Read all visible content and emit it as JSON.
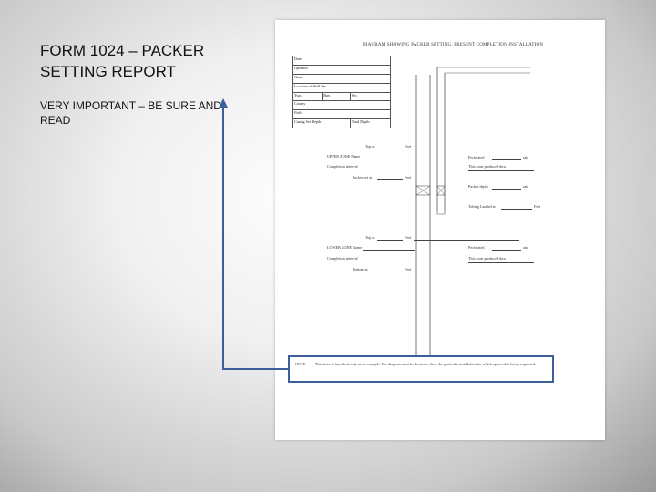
{
  "slide": {
    "title": "FORM 1024 – PACKER SETTING REPORT",
    "note": "VERY IMPORTANT – BE SURE AND READ"
  },
  "form": {
    "heading": "DIAGRAM SHOWING PACKER SETTING, PRESENT COMPLETION INSTALLATION",
    "header_rows": [
      [
        "Date",
        "",
        ""
      ],
      [
        "Operator",
        "",
        ""
      ],
      [
        "Name",
        "",
        ""
      ],
      [
        "Location of Well Sec.",
        "",
        ""
      ],
      [
        "Twp.",
        "Rge.",
        "Sec."
      ],
      [
        "County",
        "",
        ""
      ],
      [
        "Field",
        "",
        ""
      ],
      [
        "Casing Set Depth",
        "Total Depth",
        ""
      ]
    ],
    "fields": {
      "top_at_1": "Top at",
      "feet_1": "Feet",
      "upper_zone_name": "UPPER ZONE Name",
      "completion_interval_1": "Completion interval",
      "packer_set_at_1": "Packer set at",
      "feet_2": "Feet",
      "perforated_1": "Perforated",
      "rate_1": "rate",
      "zone_produced_1": "This zone produced thru",
      "packer_depth": "Packer depth",
      "rate_2": "rate",
      "tubing_landed_at": "Tubing Landed at",
      "feet_3": "Feet",
      "top_at_2": "Top at",
      "feet_4": "Feet",
      "lower_zone_name": "LOWER ZONE Name",
      "perforated_2": "Perforated",
      "rate_3": "rate",
      "completion_interval_2": "Completion interval",
      "zone_produced_2": "This zone produced thru",
      "bottom_at": "Bottom at",
      "feet_5": "Feet"
    },
    "note_label": "NOTE:",
    "note_text": "This form is furnished only as an example. The diagram must be drawn to show the particular installation for which approval is being requested."
  },
  "colors": {
    "arrow": "#3a5f9a",
    "note_border": "#3a5f9a"
  }
}
